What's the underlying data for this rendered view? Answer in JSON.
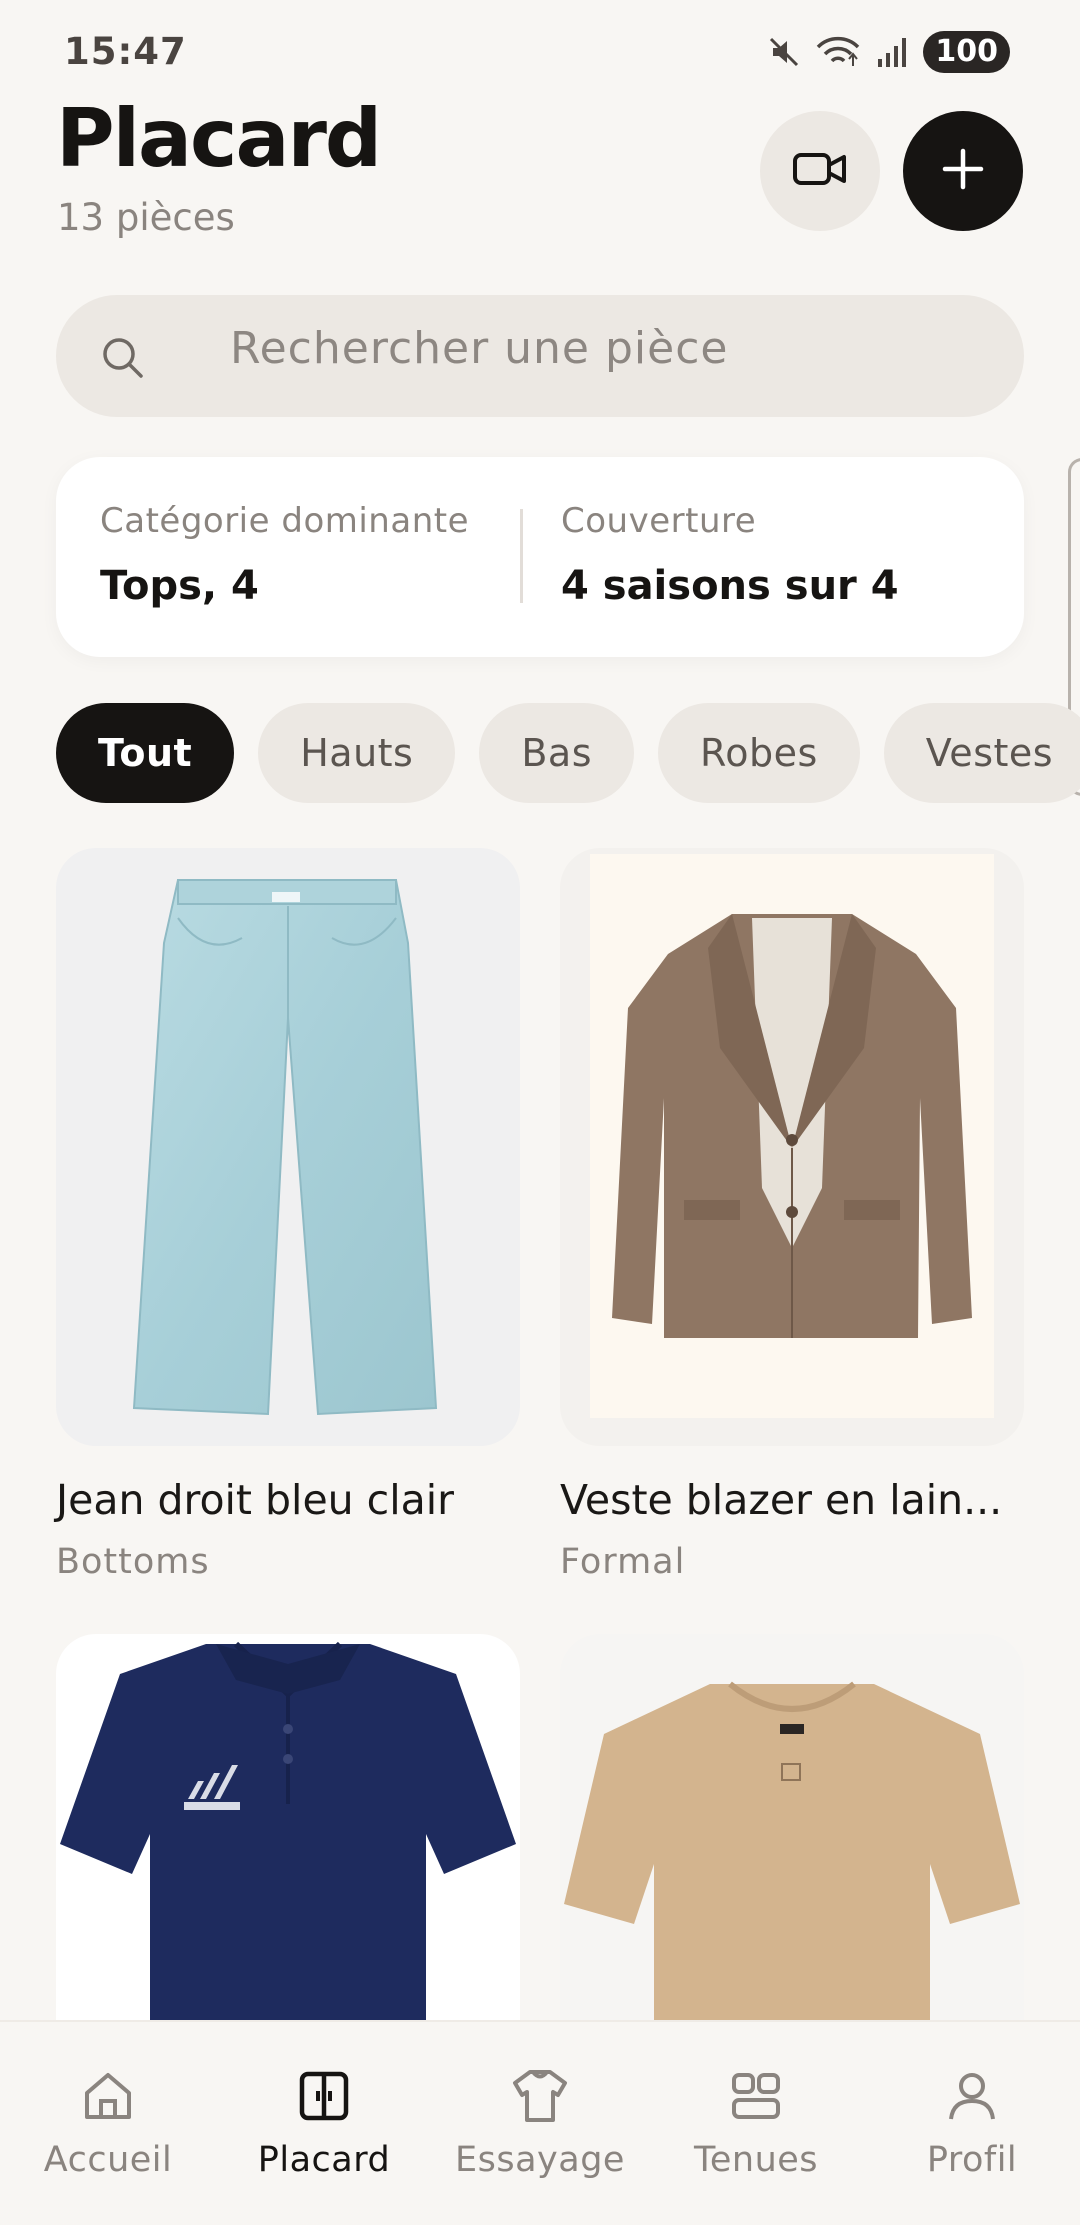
{
  "status_bar": {
    "time": "15:47",
    "battery": "100",
    "icons": [
      "mute-icon",
      "wifi-icon",
      "signal-icon"
    ]
  },
  "header": {
    "title": "Placard",
    "subtitle": "13 pièces",
    "buttons": [
      "video-camera-icon",
      "plus-icon"
    ]
  },
  "search": {
    "placeholder": "Rechercher une pièce"
  },
  "stats": {
    "dominant_label": "Catégorie dominante",
    "dominant_value": "Tops, 4",
    "coverage_label": "Couverture",
    "coverage_value": "4 saisons sur 4"
  },
  "filters": [
    {
      "label": "Tout",
      "active": true
    },
    {
      "label": "Hauts",
      "active": false
    },
    {
      "label": "Bas",
      "active": false
    },
    {
      "label": "Robes",
      "active": false
    },
    {
      "label": "Vestes",
      "active": false
    }
  ],
  "items": [
    {
      "name": "Jean droit bleu clair",
      "category": "Bottoms",
      "image": "light blue straight jeans"
    },
    {
      "name": "Veste blazer en lain...",
      "category": "Formal",
      "image": "brown wool blazer"
    },
    {
      "name": "",
      "category": "",
      "image": "navy adidas polo shirt"
    },
    {
      "name": "",
      "category": "",
      "image": "beige t-shirt"
    }
  ],
  "nav": [
    {
      "label": "Accueil",
      "icon": "home-icon",
      "active": false
    },
    {
      "label": "Placard",
      "icon": "wardrobe-icon",
      "active": true
    },
    {
      "label": "Essayage",
      "icon": "shirt-icon",
      "active": false
    },
    {
      "label": "Tenues",
      "icon": "outfits-grid-icon",
      "active": false
    },
    {
      "label": "Profil",
      "icon": "user-icon",
      "active": false
    }
  ],
  "colors": {
    "background": "#f8f6f3",
    "accent_dark": "#161412",
    "chip_bg": "#ece8e3",
    "muted_text": "#8a847f"
  }
}
